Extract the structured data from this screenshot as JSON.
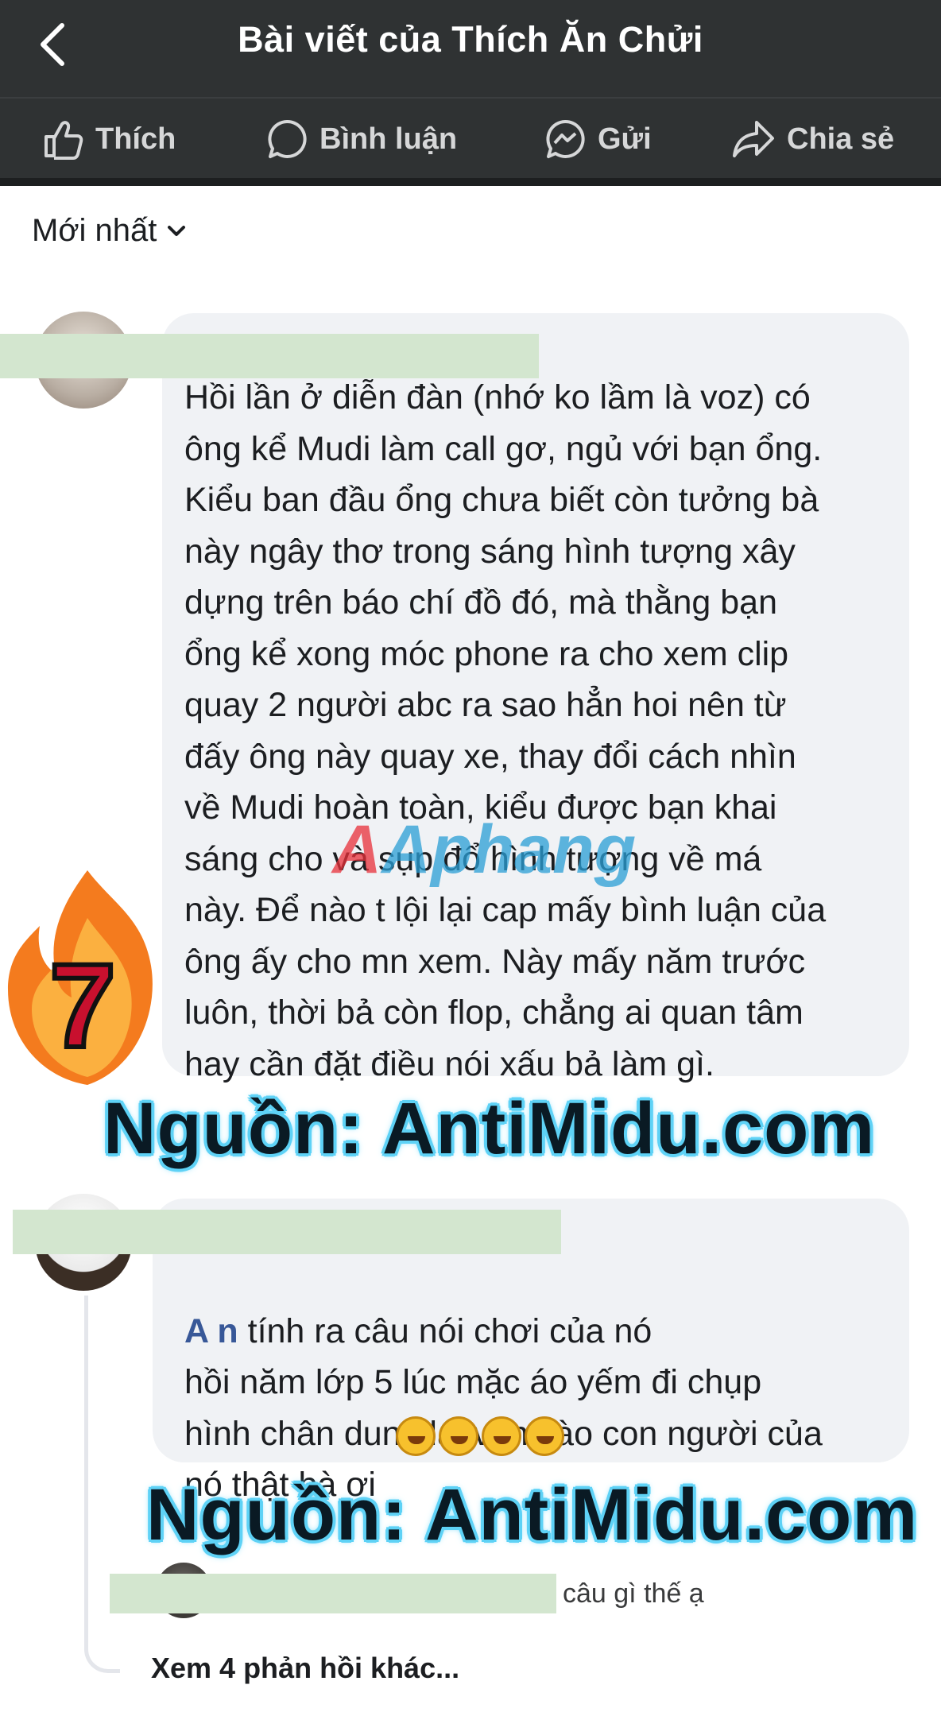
{
  "header": {
    "title": "Bài viết của Thích Ăn Chửi"
  },
  "actions": {
    "like": "Thích",
    "comment": "Bình luận",
    "send": "Gửi",
    "share": "Chia sẻ"
  },
  "sort": {
    "label": "Mới nhất"
  },
  "comments": [
    {
      "text": "Hồi lần ở diễn đàn (nhớ ko lầm là voz) có\nông kể Mudi làm call gơ, ngủ với bạn ổng.\nKiểu ban đầu ổng chưa biết còn tưởng bà\nnày ngây thơ trong sáng hình tượng xây\ndựng trên báo chí đồ đó, mà thằng bạn\nổng kể xong móc phone ra cho xem clip\nquay 2 người abc ra sao hẳn hoi nên từ\nđấy ông này quay xe, thay đổi cách nhìn\nvề Mudi hoàn toàn, kiểu được bạn khai\nsáng cho và sụp đổ hình tượng về má\nnày. Để nào t lội lại cap mấy bình luận của\nông ấy cho mn xem. Này mấy năm trước\nluôn, thời bả còn flop, chẳng ai quan tâm\nhay cần đặt điều nói xấu bả làm gì."
    },
    {
      "mention": "A          n",
      "text": " tính ra câu nói chơi của nó\nhồi năm lớp 5 lúc mặc áo yếm đi chụp\nhình chân dung lại vận vào con người của\nnó thật bà ơi"
    }
  ],
  "reply": {
    "text": "câu gì thế ạ"
  },
  "more_replies": "Xem 4 phản hồi khác...",
  "watermarks": {
    "source": "Nguồn: AntiMidu.com",
    "logo": "Aphang",
    "badge_number": "7"
  },
  "colors": {
    "header_bg": "#2f3233",
    "bubble_bg": "#f0f2f5",
    "mention": "#385898",
    "watermark_glow": "#5fd2f6",
    "redaction": "#d3e6cf"
  }
}
